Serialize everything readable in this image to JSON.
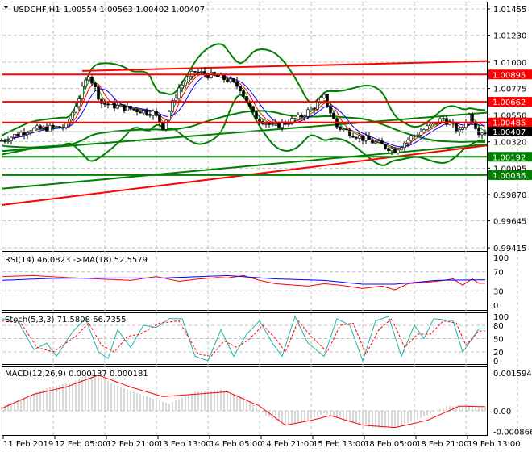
{
  "header": {
    "symbol_label": "USDCHF,H1",
    "ohlc": "1.00554 1.00563 1.00402 1.00407"
  },
  "chart_data": {
    "type": "candlestick",
    "price_axis": {
      "min": 0.99415,
      "max": 1.01455,
      "ticks": [
        "1.01455",
        "1.01230",
        "1.01000",
        "1.00775",
        "1.00550",
        "1.00320",
        "1.00095",
        "0.99870",
        "0.99645",
        "0.99415"
      ]
    },
    "levels": [
      {
        "price": 1.00895,
        "label": "1.00895",
        "color": "#ff0000"
      },
      {
        "price": 1.00662,
        "label": "1.00662",
        "color": "#ff0000"
      },
      {
        "price": 1.00485,
        "label": "1.00485",
        "color": "#ff0000"
      },
      {
        "price": 1.00192,
        "label": "1.00192",
        "color": "#008000"
      },
      {
        "price": 1.00036,
        "label": "1.00036",
        "color": "#008000"
      }
    ],
    "current_price": {
      "price": 1.00407,
      "label": "1.00407"
    },
    "trendlines": [
      {
        "from": [
          25,
          1.00925
        ],
        "to": [
          151,
          1.0101
        ],
        "color": "#ff0000"
      },
      {
        "from": [
          0,
          0.9978
        ],
        "to": [
          151,
          1.0029
        ],
        "color": "#ff0000"
      },
      {
        "from": [
          0,
          0.9992
        ],
        "to": [
          151,
          1.003
        ],
        "color": "#008000"
      },
      {
        "from": [
          0,
          1.0024
        ],
        "to": [
          151,
          1.0057
        ],
        "color": "#008000"
      }
    ],
    "close_keypoints": [
      [
        0,
        1.0033
      ],
      [
        8,
        1.0042
      ],
      [
        20,
        1.0045
      ],
      [
        24,
        1.007
      ],
      [
        27,
        1.009
      ],
      [
        31,
        1.0065
      ],
      [
        40,
        1.006
      ],
      [
        47,
        1.0057
      ],
      [
        50,
        1.0045
      ],
      [
        55,
        1.0078
      ],
      [
        60,
        1.0092
      ],
      [
        70,
        1.0085
      ],
      [
        74,
        1.0078
      ],
      [
        78,
        1.0055
      ],
      [
        84,
        1.0045
      ],
      [
        92,
        1.0052
      ],
      [
        97,
        1.0062
      ],
      [
        100,
        1.007
      ],
      [
        104,
        1.0045
      ],
      [
        112,
        1.0035
      ],
      [
        122,
        1.0025
      ],
      [
        127,
        1.0036
      ],
      [
        137,
        1.0052
      ],
      [
        142,
        1.004
      ],
      [
        145,
        1.0055
      ],
      [
        148,
        1.0041
      ]
    ],
    "time_labels": [
      "11 Feb 2019",
      "12 Feb 05:00",
      "12 Feb 21:00",
      "13 Feb 13:00",
      "14 Feb 05:00",
      "14 Feb 21:00",
      "15 Feb 13:00",
      "18 Feb 05:00",
      "18 Feb 21:00",
      "19 Feb 13:00"
    ],
    "rsi": {
      "title": "RSI(14) 46.0823  ->MA(18) 52.5579",
      "ticks": [
        "100",
        "70",
        "30",
        "0"
      ],
      "rsi_keypoints": [
        [
          0,
          60
        ],
        [
          10,
          62
        ],
        [
          20,
          58
        ],
        [
          30,
          55
        ],
        [
          40,
          52
        ],
        [
          48,
          60
        ],
        [
          55,
          50
        ],
        [
          60,
          54
        ],
        [
          67,
          58
        ],
        [
          70,
          57
        ],
        [
          75,
          62
        ],
        [
          80,
          52
        ],
        [
          85,
          45
        ],
        [
          95,
          40
        ],
        [
          100,
          45
        ],
        [
          105,
          42
        ],
        [
          112,
          35
        ],
        [
          118,
          40
        ],
        [
          122,
          32
        ],
        [
          126,
          45
        ],
        [
          135,
          50
        ],
        [
          140,
          55
        ],
        [
          143,
          42
        ],
        [
          146,
          55
        ],
        [
          148,
          46
        ]
      ],
      "ma_keypoints": [
        [
          0,
          52
        ],
        [
          15,
          56
        ],
        [
          30,
          57
        ],
        [
          50,
          57
        ],
        [
          70,
          62
        ],
        [
          85,
          55
        ],
        [
          100,
          52
        ],
        [
          112,
          44
        ],
        [
          122,
          44
        ],
        [
          135,
          52
        ],
        [
          148,
          53
        ]
      ]
    },
    "stoch": {
      "title": "Stoch(5,3,3) 71.5808 66.7355",
      "ticks": [
        "100",
        "80",
        "50",
        "20",
        "0"
      ],
      "main_keypoints": [
        [
          0,
          95
        ],
        [
          5,
          90
        ],
        [
          10,
          25
        ],
        [
          14,
          40
        ],
        [
          17,
          10
        ],
        [
          22,
          65
        ],
        [
          26,
          95
        ],
        [
          30,
          20
        ],
        [
          33,
          5
        ],
        [
          36,
          70
        ],
        [
          40,
          30
        ],
        [
          44,
          80
        ],
        [
          48,
          75
        ],
        [
          52,
          95
        ],
        [
          56,
          95
        ],
        [
          60,
          10
        ],
        [
          64,
          0
        ],
        [
          68,
          70
        ],
        [
          72,
          10
        ],
        [
          76,
          60
        ],
        [
          80,
          90
        ],
        [
          84,
          40
        ],
        [
          87,
          10
        ],
        [
          91,
          100
        ],
        [
          95,
          40
        ],
        [
          100,
          10
        ],
        [
          104,
          95
        ],
        [
          108,
          80
        ],
        [
          112,
          0
        ],
        [
          116,
          90
        ],
        [
          120,
          100
        ],
        [
          124,
          10
        ],
        [
          128,
          80
        ],
        [
          131,
          50
        ],
        [
          134,
          95
        ],
        [
          140,
          90
        ],
        [
          143,
          20
        ],
        [
          146,
          50
        ],
        [
          148,
          72
        ]
      ],
      "signal_keypoints": [
        [
          0,
          90
        ],
        [
          6,
          85
        ],
        [
          11,
          30
        ],
        [
          16,
          20
        ],
        [
          23,
          55
        ],
        [
          27,
          85
        ],
        [
          31,
          35
        ],
        [
          35,
          20
        ],
        [
          39,
          55
        ],
        [
          43,
          60
        ],
        [
          49,
          85
        ],
        [
          55,
          90
        ],
        [
          61,
          15
        ],
        [
          65,
          10
        ],
        [
          69,
          45
        ],
        [
          73,
          30
        ],
        [
          77,
          50
        ],
        [
          81,
          80
        ],
        [
          85,
          50
        ],
        [
          88,
          20
        ],
        [
          92,
          90
        ],
        [
          96,
          55
        ],
        [
          101,
          20
        ],
        [
          105,
          80
        ],
        [
          109,
          85
        ],
        [
          113,
          15
        ],
        [
          117,
          70
        ],
        [
          121,
          95
        ],
        [
          125,
          30
        ],
        [
          129,
          60
        ],
        [
          133,
          60
        ],
        [
          137,
          90
        ],
        [
          141,
          85
        ],
        [
          144,
          35
        ],
        [
          148,
          67
        ]
      ]
    },
    "macd": {
      "title": "MACD(12,26,9) 0.000137 0.000181",
      "ticks": [
        "0.001594",
        "0.00",
        "-0.000866"
      ],
      "min": -0.000866,
      "max": 0.001594,
      "hist_keypoints": [
        [
          0,
          0.0002
        ],
        [
          8,
          0.0006
        ],
        [
          15,
          0.001
        ],
        [
          22,
          0.0012
        ],
        [
          28,
          0.0016
        ],
        [
          35,
          0.0011
        ],
        [
          45,
          0.0006
        ],
        [
          52,
          0.0003
        ],
        [
          60,
          0.0008
        ],
        [
          68,
          0.0009
        ],
        [
          75,
          0.0006
        ],
        [
          82,
          -0.0002
        ],
        [
          88,
          -0.0006
        ],
        [
          95,
          -0.0004
        ],
        [
          100,
          -0.0001
        ],
        [
          106,
          -0.0004
        ],
        [
          115,
          -0.0007
        ],
        [
          122,
          -0.0007
        ],
        [
          130,
          -0.0003
        ],
        [
          138,
          0.0002
        ],
        [
          144,
          0.0002
        ],
        [
          148,
          0.00014
        ]
      ],
      "signal_keypoints": [
        [
          0,
          0.0001
        ],
        [
          10,
          0.0007
        ],
        [
          20,
          0.001
        ],
        [
          30,
          0.0015
        ],
        [
          40,
          0.001
        ],
        [
          50,
          0.0006
        ],
        [
          60,
          0.0007
        ],
        [
          70,
          0.0008
        ],
        [
          80,
          0.0002
        ],
        [
          88,
          -0.0006
        ],
        [
          96,
          -0.0004
        ],
        [
          102,
          -0.0002
        ],
        [
          112,
          -0.0006
        ],
        [
          122,
          -0.0007
        ],
        [
          132,
          -0.0004
        ],
        [
          142,
          0.0002
        ],
        [
          148,
          0.00018
        ]
      ]
    }
  }
}
